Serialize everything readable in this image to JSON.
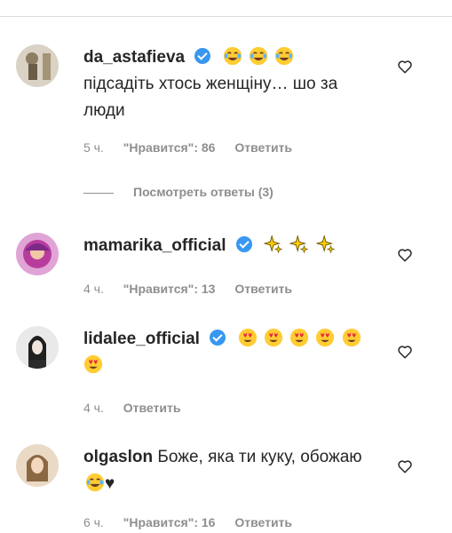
{
  "comments": [
    {
      "username": "da_astafieva",
      "verified": true,
      "emoji_after_name": [
        "face-with-tears-of-joy",
        "face-with-tears-of-joy",
        "face-with-tears-of-joy"
      ],
      "text": "підсадіть хтось женщіну… шо за люди",
      "time": "5 ч.",
      "likes": "\"Нравится\": 86",
      "reply": "Ответить",
      "avatar_color": "#b8a98c"
    },
    {
      "username": "mamarika_official",
      "verified": true,
      "emoji_after_name": [
        "sparkles",
        "sparkles",
        "sparkles"
      ],
      "time": "4 ч.",
      "likes": "\"Нравится\": 13",
      "reply": "Ответить",
      "avatar_color": "#c64da6"
    },
    {
      "username": "lidalee_official",
      "verified": true,
      "emoji_after_name": [
        "heart-eyes",
        "heart-eyes",
        "heart-eyes",
        "heart-eyes",
        "heart-eyes",
        "heart-eyes"
      ],
      "time": "4 ч.",
      "reply": "Ответить",
      "avatar_color": "#5a5a5a"
    },
    {
      "username": "olgaslon",
      "verified": false,
      "text": "Боже, яка ти куку, обожаю",
      "text_emoji": [
        "face-with-tears-of-joy"
      ],
      "text_suffix": "♥",
      "time": "6 ч.",
      "likes": "\"Нравится\": 16",
      "reply": "Ответить",
      "avatar_color": "#b8906e"
    }
  ],
  "replies_toggle": "Посмотреть ответы (3)",
  "icons": {
    "like": "heart-outline-icon",
    "verified": "verified-badge-icon"
  },
  "colors": {
    "primary_text": "#262626",
    "secondary_text": "#8e8e8e",
    "verified": "#3897f0"
  }
}
